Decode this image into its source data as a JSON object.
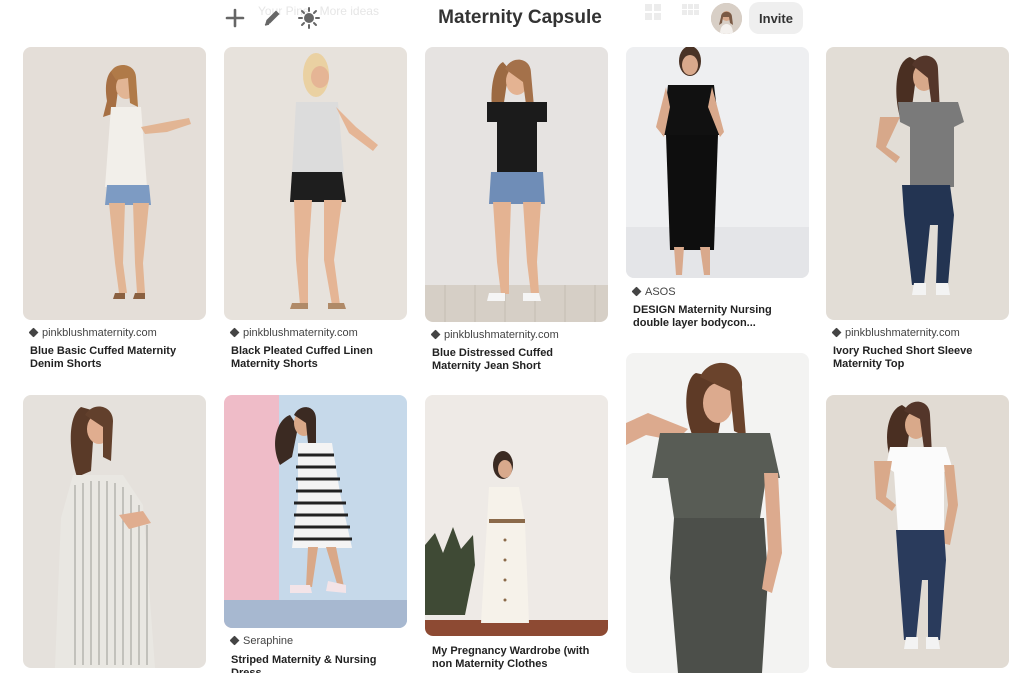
{
  "header": {
    "faded_search_text": "Your Pins · More ideas",
    "title": "Maternity Capsule",
    "invite_label": "Invite",
    "icons": [
      "plus-icon",
      "pencil-icon",
      "sparkle-icon"
    ]
  },
  "pins": [
    {
      "source": "pinkblushmaternity.com",
      "title": "Blue Basic Cuffed Maternity Denim Shorts"
    },
    {
      "source": "pinkblushmaternity.com",
      "title": "Black Pleated Cuffed Linen Maternity Shorts"
    },
    {
      "source": "pinkblushmaternity.com",
      "title": "Blue Distressed Cuffed Maternity Jean Short"
    },
    {
      "source": "ASOS",
      "title": "DESIGN Maternity Nursing double layer bodycon..."
    },
    {
      "source": "pinkblushmaternity.com",
      "title": "Ivory Ruched Short Sleeve Maternity Top"
    },
    {
      "source": "",
      "title": ""
    },
    {
      "source": "Seraphine",
      "title": "Striped Maternity & Nursing Dress"
    },
    {
      "source": "",
      "title": "My Pregnancy Wardrobe (with non Maternity Clothes"
    },
    {
      "source": "",
      "title": ""
    },
    {
      "source": "",
      "title": ""
    }
  ],
  "colors": {
    "background": "#ffffff",
    "invite_bg": "#efefef",
    "text": "#333333"
  }
}
